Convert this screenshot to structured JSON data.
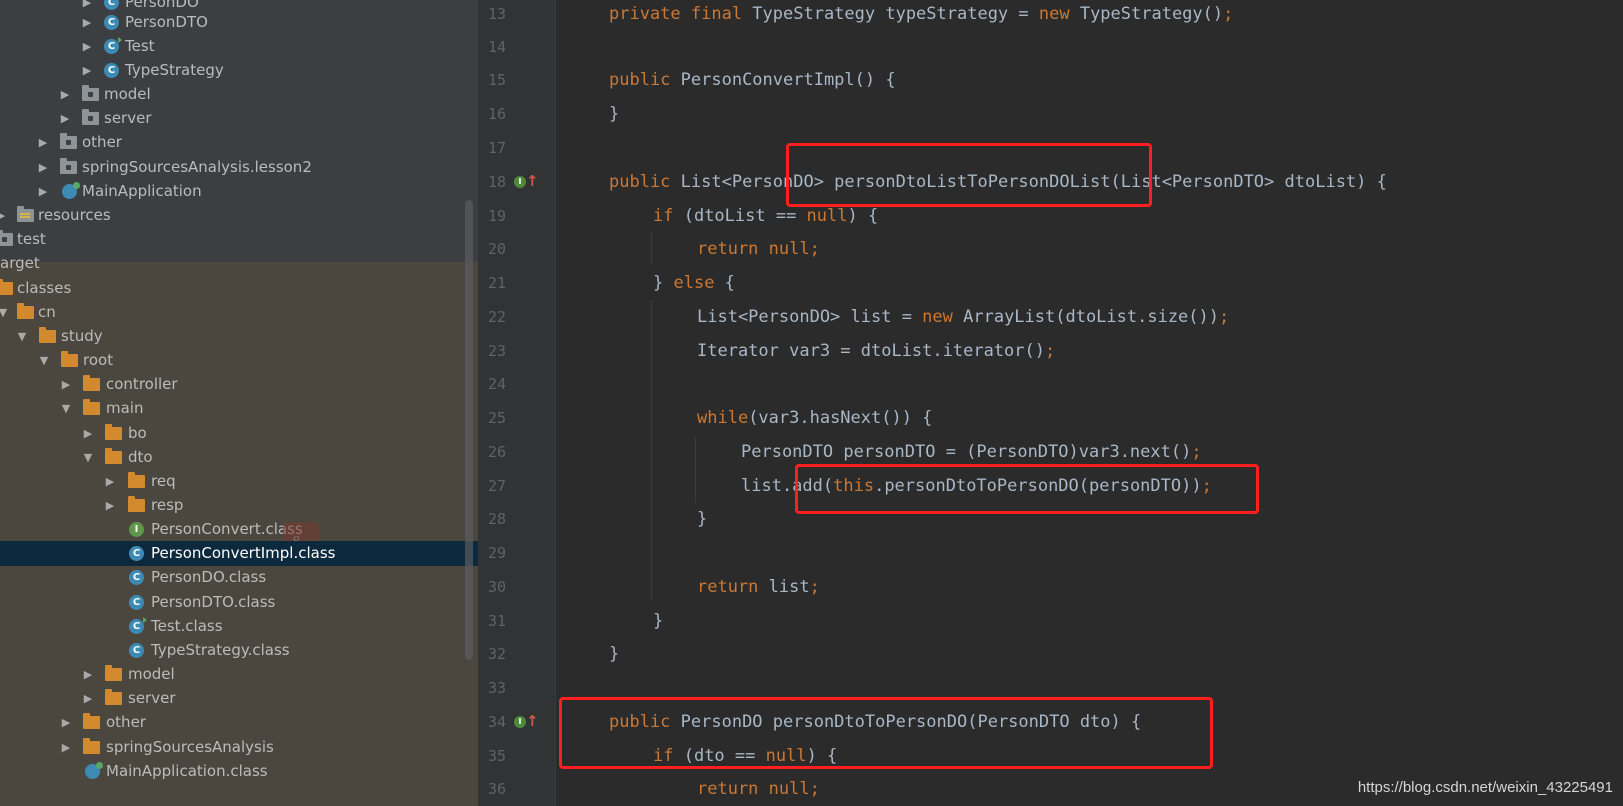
{
  "tree": {
    "items": [
      {
        "label": "PersonDO",
        "icon": "class-icon"
      },
      {
        "label": "PersonDTO",
        "icon": "class-icon"
      },
      {
        "label": "Test",
        "icon": "test-class-icon"
      },
      {
        "label": "TypeStrategy",
        "icon": "class-icon"
      },
      {
        "label": "model",
        "icon": "package-folder-icon"
      },
      {
        "label": "server",
        "icon": "package-folder-icon"
      },
      {
        "label": "other",
        "icon": "package-folder-icon"
      },
      {
        "label": "springSourcesAnalysis.lesson2",
        "icon": "package-folder-icon"
      },
      {
        "label": "MainApplication",
        "icon": "spring-app-icon"
      },
      {
        "label": "resources",
        "icon": "resources-folder-icon"
      },
      {
        "label": "test",
        "icon": "folder-icon"
      },
      {
        "label": "arget",
        "icon": ""
      },
      {
        "label": "classes",
        "icon": "folder-icon"
      },
      {
        "label": "cn",
        "icon": "folder-icon"
      },
      {
        "label": "study",
        "icon": "folder-icon"
      },
      {
        "label": "root",
        "icon": "folder-icon"
      },
      {
        "label": "controller",
        "icon": "folder-icon"
      },
      {
        "label": "main",
        "icon": "folder-icon"
      },
      {
        "label": "bo",
        "icon": "folder-icon"
      },
      {
        "label": "dto",
        "icon": "folder-icon"
      },
      {
        "label": "req",
        "icon": "folder-icon"
      },
      {
        "label": "resp",
        "icon": "folder-icon"
      },
      {
        "label": "PersonConvert.class",
        "icon": "interface-icon"
      },
      {
        "label": "PersonConvertImpl.class",
        "icon": "class-icon"
      },
      {
        "label": "PersonDO.class",
        "icon": "class-icon"
      },
      {
        "label": "PersonDTO.class",
        "icon": "class-icon"
      },
      {
        "label": "Test.class",
        "icon": "test-class-icon"
      },
      {
        "label": "TypeStrategy.class",
        "icon": "class-icon"
      },
      {
        "label": "model",
        "icon": "folder-icon"
      },
      {
        "label": "server",
        "icon": "folder-icon"
      },
      {
        "label": "other",
        "icon": "folder-icon"
      },
      {
        "label": "springSourcesAnalysis",
        "icon": "folder-icon"
      },
      {
        "label": "MainApplication.class",
        "icon": "spring-app-icon"
      }
    ],
    "selected": "PersonConvertImpl.class"
  },
  "editor": {
    "line_numbers": [
      "13",
      "14",
      "15",
      "16",
      "17",
      "18",
      "19",
      "20",
      "21",
      "22",
      "23",
      "24",
      "25",
      "26",
      "27",
      "28",
      "29",
      "30",
      "31",
      "32",
      "33",
      "34",
      "35",
      "36"
    ],
    "code": {
      "l13": {
        "a": "private final",
        "b": " TypeStrategy typeStrategy = ",
        "c": "new",
        " d": "",
        "e": " TypeStrategy()",
        "f": ";"
      },
      "l15": {
        "a": "public",
        " b": "",
        "c": " PersonConvertImpl() {"
      },
      "l16": "}",
      "l18": {
        "a": "public",
        "b": " List<PersonDO> personDtoListToPersonDOList(List<PersonDTO> dtoList) {"
      },
      "l19": {
        "a": "if",
        "b": " (dtoList == ",
        "c": "null",
        "d": ") {"
      },
      "l20": {
        "a": "return null",
        "b": ";"
      },
      "l21": {
        "a": "} ",
        "b": "else",
        "c": " {"
      },
      "l22": {
        "a": "List<PersonDO> list = ",
        "b": "new",
        "c": " ArrayList(dtoList.size())",
        "d": ";"
      },
      "l23": {
        "a": "Iterator var3 = dtoList.iterator()",
        "b": ";"
      },
      "l25": {
        "a": "while",
        "b": "(var3.hasNext()) {"
      },
      "l26": {
        "a": "PersonDTO personDTO = (PersonDTO)var3.next()",
        "b": ";"
      },
      "l27": {
        "a": "list.add(",
        "b": "this",
        "c": ".personDtoToPersonDO(personDTO))",
        "d": ";"
      },
      "l28": "}",
      "l30": {
        "a": "return",
        "b": " list",
        "c": ";"
      },
      "l31": "}",
      "l32": "}",
      "l34": {
        "a": "public",
        "b": " PersonDO personDtoToPersonDO(PersonDTO dto) {"
      },
      "l35": {
        "a": "if",
        "b": " (dto == ",
        "c": "null",
        "d": ") {"
      },
      "l36": {
        "a": "return null",
        "b": ";"
      }
    }
  },
  "watermark": "https://blog.csdn.net/weixin_43225491",
  "colors": {
    "keyword": "#cc7832",
    "text": "#a9b7c6",
    "tree_bg": "#3c3f41",
    "target_bg": "#4b473f",
    "selection": "#0d293e",
    "highlight_box": "#ff1f1f"
  }
}
